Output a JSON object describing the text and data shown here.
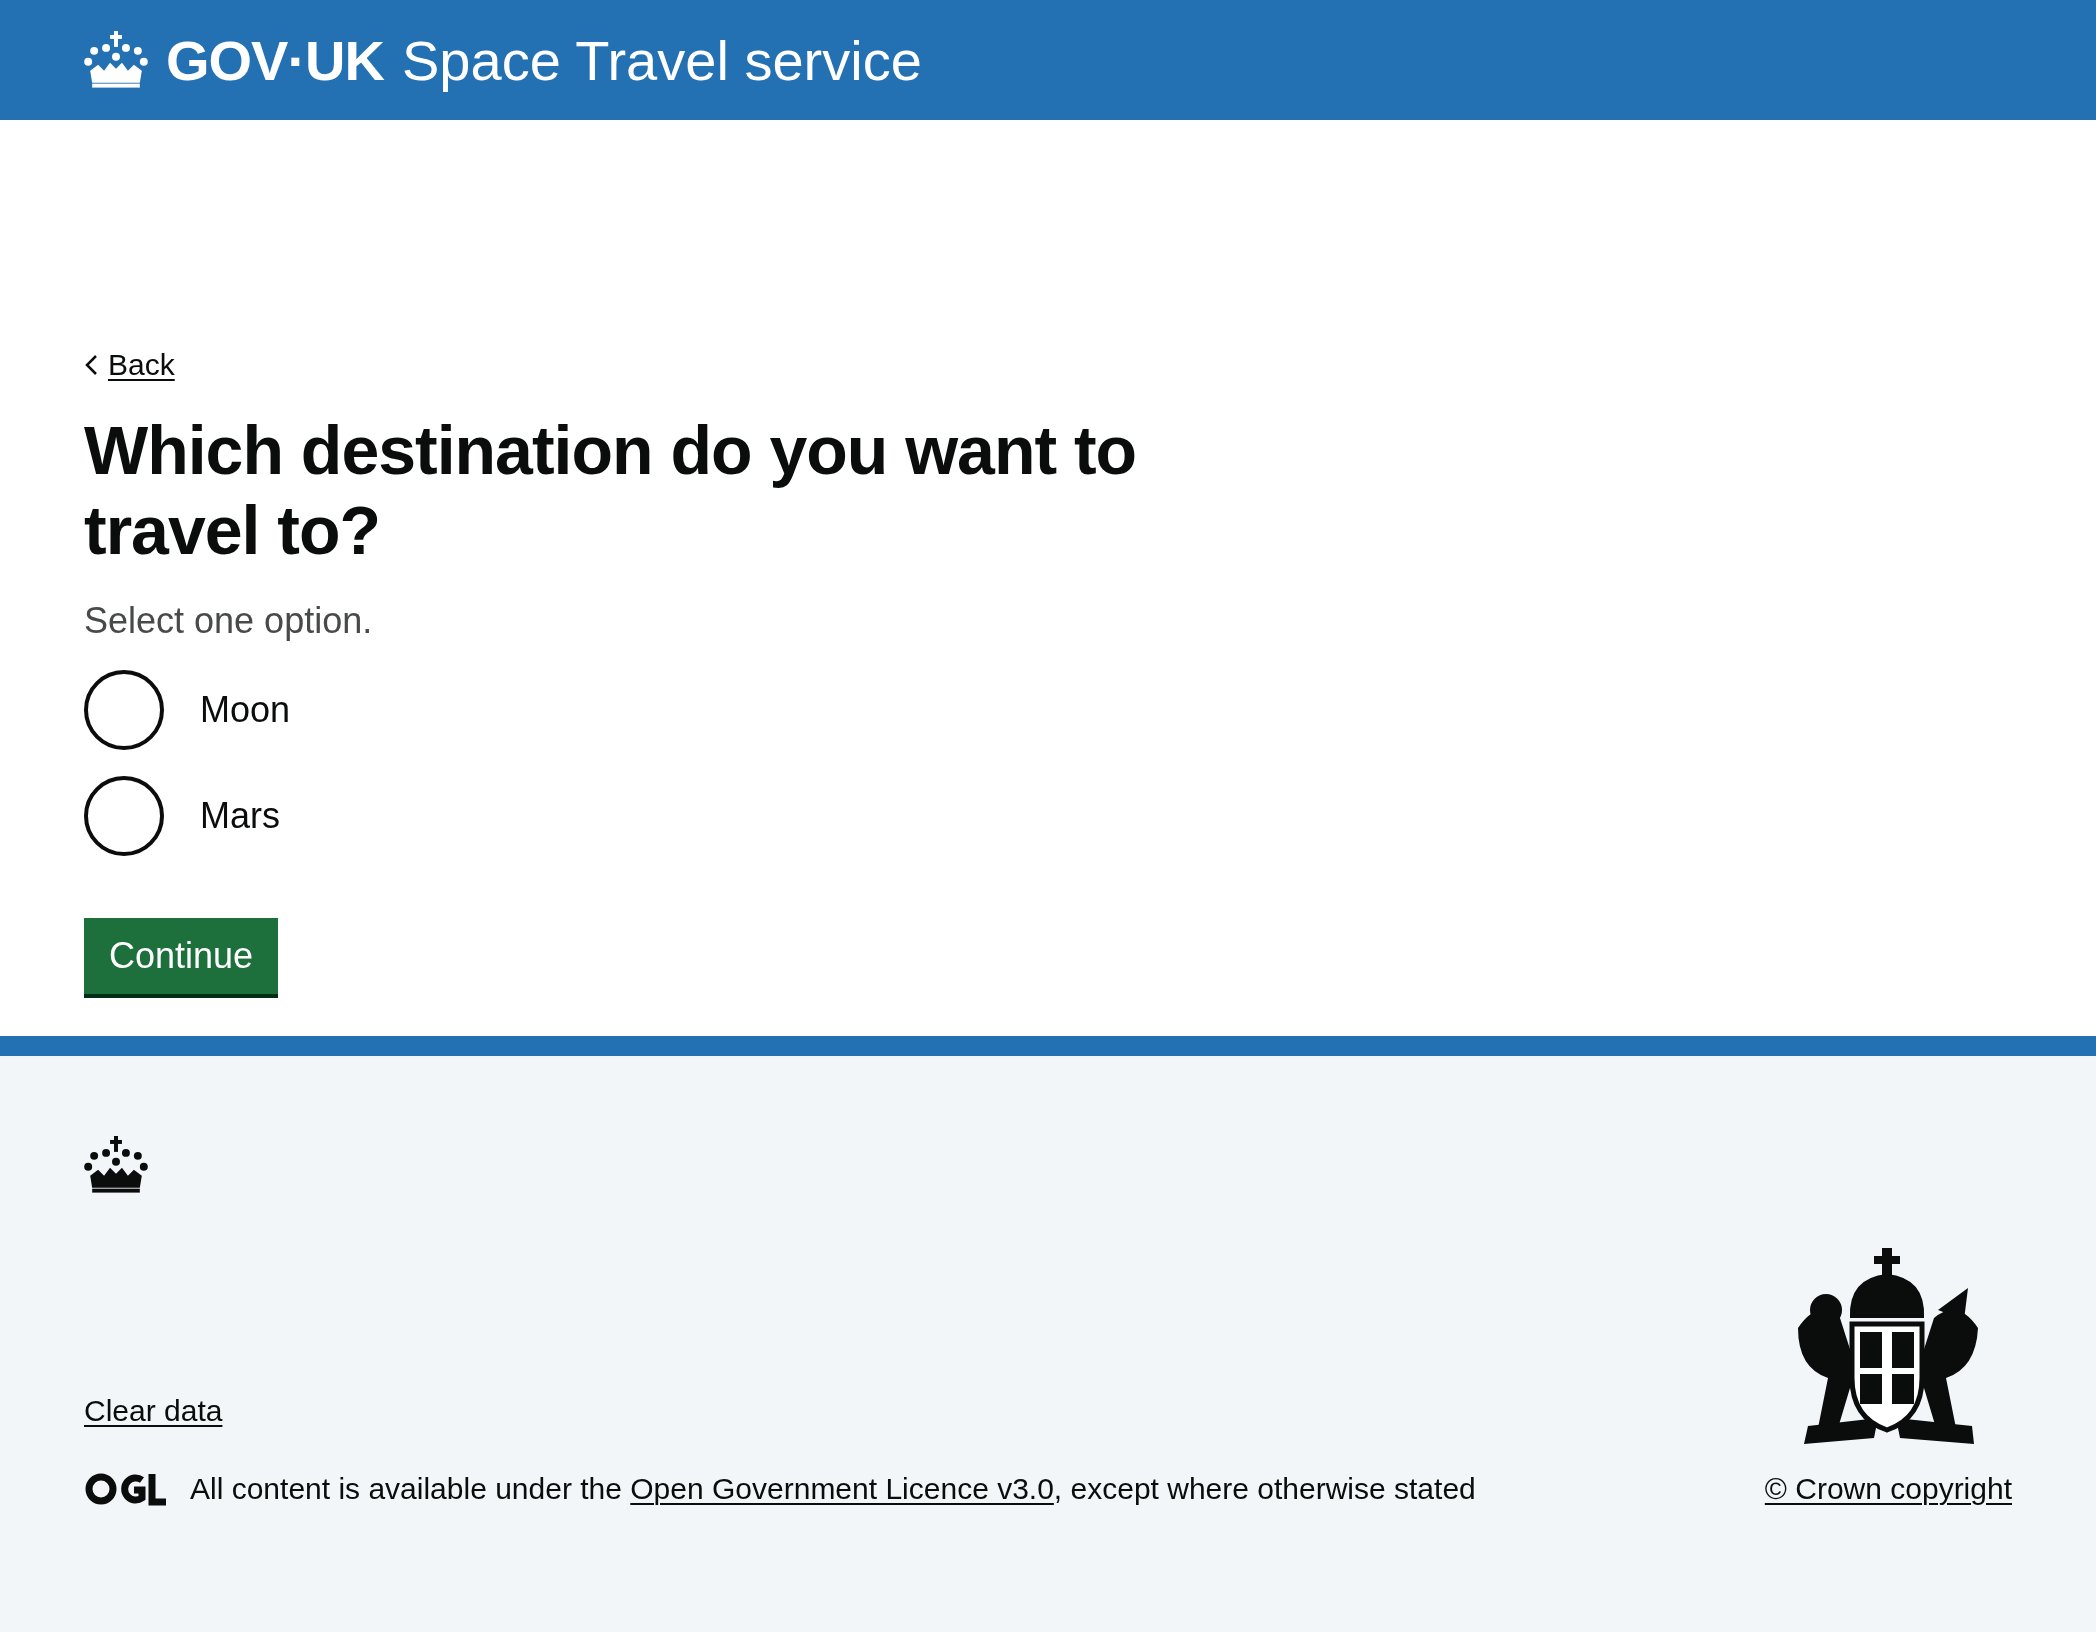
{
  "header": {
    "logo_text": "GOV·UK",
    "service_name": "Space Travel service"
  },
  "back_link": "Back",
  "question": {
    "heading": "Which destination do you want to travel to?",
    "hint": "Select one option.",
    "options": [
      {
        "label": "Moon",
        "selected": false
      },
      {
        "label": "Mars",
        "selected": false
      }
    ]
  },
  "continue_button": "Continue",
  "footer": {
    "clear_data_link": "Clear data",
    "licence_prefix": "All content is available under the ",
    "licence_link": "Open Government Licence v3.0",
    "licence_suffix": ", except where otherwise stated",
    "copyright_link": "© Crown copyright"
  }
}
